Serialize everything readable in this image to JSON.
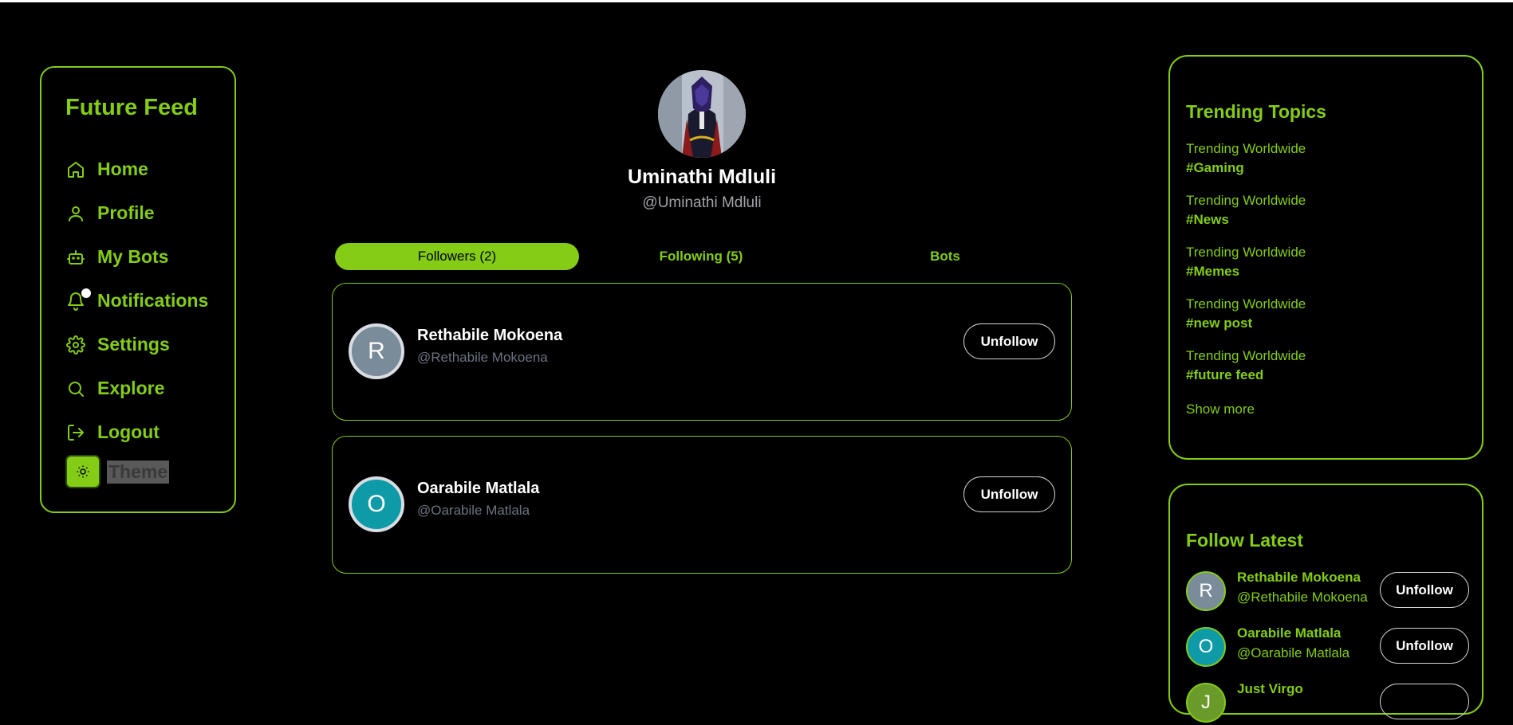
{
  "colors": {
    "accent": "#84cc16",
    "background": "#000000",
    "avatar_r": "#7a8b99",
    "avatar_o": "#0e9aa7"
  },
  "sidebar": {
    "brand": "Future Feed",
    "items": [
      {
        "label": "Home",
        "icon": "home-icon"
      },
      {
        "label": "Profile",
        "icon": "user-icon"
      },
      {
        "label": "My Bots",
        "icon": "bot-icon"
      },
      {
        "label": "Notifications",
        "icon": "bell-icon"
      },
      {
        "label": "Settings",
        "icon": "gear-icon"
      },
      {
        "label": "Explore",
        "icon": "search-icon"
      },
      {
        "label": "Logout",
        "icon": "logout-icon"
      }
    ],
    "theme_label": "Theme"
  },
  "profile": {
    "name": "Uminathi Mdluli",
    "handle": "@Uminathi Mdluli"
  },
  "tabs": [
    {
      "label": "Followers (2)",
      "active": true
    },
    {
      "label": "Following (5)",
      "active": false
    },
    {
      "label": "Bots",
      "active": false
    }
  ],
  "followers": [
    {
      "initial": "R",
      "name": "Rethabile Mokoena",
      "handle": "@Rethabile Mokoena",
      "button": "Unfollow"
    },
    {
      "initial": "O",
      "name": "Oarabile Matlala",
      "handle": "@Oarabile Matlala",
      "button": "Unfollow"
    }
  ],
  "trending": {
    "title": "Trending Topics",
    "items": [
      {
        "sub": "Trending Worldwide",
        "tag": "#Gaming"
      },
      {
        "sub": "Trending Worldwide",
        "tag": "#News"
      },
      {
        "sub": "Trending Worldwide",
        "tag": "#Memes"
      },
      {
        "sub": "Trending Worldwide",
        "tag": "#new post"
      },
      {
        "sub": "Trending Worldwide",
        "tag": "#future feed"
      }
    ],
    "show_more": "Show more"
  },
  "follow_latest": {
    "title": "Follow Latest",
    "items": [
      {
        "initial": "R",
        "name": "Rethabile Mokoena",
        "handle": "@Rethabile Mokoena",
        "button": "Unfollow"
      },
      {
        "initial": "O",
        "name": "Oarabile Matlala",
        "handle": "@Oarabile Matlala",
        "button": "Unfollow"
      },
      {
        "initial": "J",
        "name": "Just Virgo",
        "handle": "",
        "button": ""
      }
    ]
  }
}
